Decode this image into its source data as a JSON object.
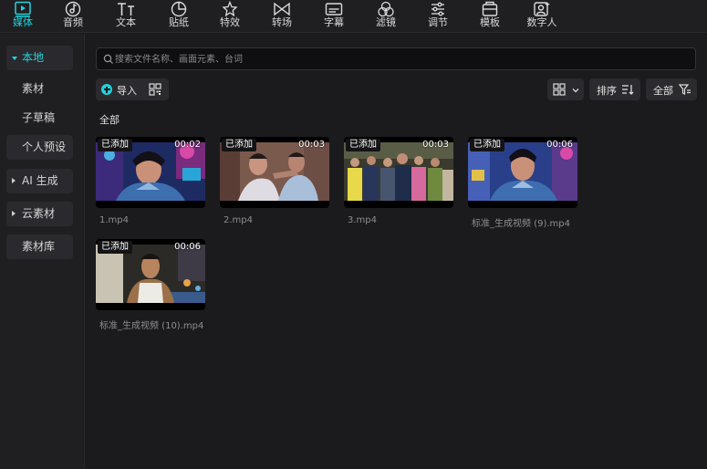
{
  "toolbar": {
    "tools": [
      {
        "id": "media",
        "label": "媒体",
        "icon": "media-icon"
      },
      {
        "id": "audio",
        "label": "音频",
        "icon": "audio-icon"
      },
      {
        "id": "text",
        "label": "文本",
        "icon": "text-icon"
      },
      {
        "id": "sticker",
        "label": "贴纸",
        "icon": "sticker-icon"
      },
      {
        "id": "effects",
        "label": "特效",
        "icon": "effects-icon"
      },
      {
        "id": "transitions",
        "label": "转场",
        "icon": "transition-icon"
      },
      {
        "id": "subtitles",
        "label": "字幕",
        "icon": "subtitle-icon"
      },
      {
        "id": "filters",
        "label": "滤镜",
        "icon": "filter-icon"
      },
      {
        "id": "adjust",
        "label": "调节",
        "icon": "adjust-icon"
      },
      {
        "id": "templates",
        "label": "模板",
        "icon": "template-icon"
      },
      {
        "id": "digital_human",
        "label": "数字人",
        "icon": "digital-human-icon"
      }
    ],
    "active": "media",
    "accent_color": "#22d3dc"
  },
  "sidebar": {
    "items": [
      {
        "label": "本地",
        "active": true,
        "expanded": true
      },
      {
        "label": "素材",
        "sub": true
      },
      {
        "label": "子草稿",
        "sub": true
      },
      {
        "label": "个人预设"
      },
      {
        "label": "AI 生成",
        "collapsed": true
      },
      {
        "label": "云素材",
        "collapsed": true
      },
      {
        "label": "素材库"
      }
    ]
  },
  "search": {
    "placeholder": "搜索文件名称、画面元素、台词",
    "value": ""
  },
  "actions": {
    "import_label": "导入",
    "sort_label": "排序",
    "filter_label": "全部"
  },
  "section_title": "全部",
  "media_items": [
    {
      "name": "1.mp4",
      "duration": "00:02",
      "badge": "已添加"
    },
    {
      "name": "2.mp4",
      "duration": "00:03",
      "badge": "已添加"
    },
    {
      "name": "3.mp4",
      "duration": "00:03",
      "badge": "已添加"
    },
    {
      "name": "标准_生成视频 (9).mp4",
      "duration": "00:06",
      "badge": "已添加"
    },
    {
      "name": "标准_生成视频 (10).mp4",
      "duration": "00:06",
      "badge": "已添加"
    }
  ]
}
